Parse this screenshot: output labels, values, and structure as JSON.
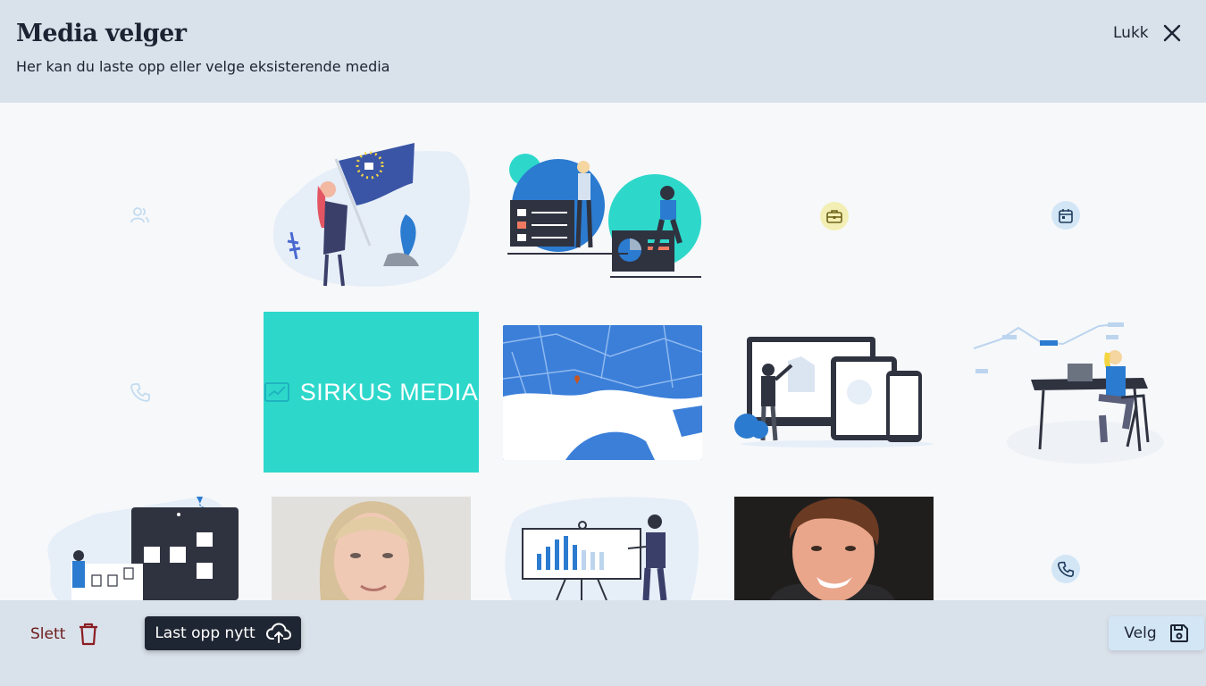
{
  "header": {
    "title": "Media velger",
    "subtitle": "Her kan du laste opp eller velge eksisterende media",
    "close_label": "Lukk"
  },
  "grid": {
    "sirkus_text": "SIRKUS MEDIA",
    "placeholder_icons": [
      "users-icon",
      "briefcase-icon",
      "calendar-icon",
      "phone-icon",
      "phone-icon"
    ]
  },
  "footer": {
    "delete_label": "Slett",
    "upload_label": "Last opp nytt",
    "select_label": "Velg"
  },
  "colors": {
    "header_bg": "#d9e1ea",
    "dark_button": "#1f2633",
    "select_button": "#d3e6f6",
    "delete_text": "#6b1a1a",
    "sirkus_bg": "#2dd8cb"
  }
}
